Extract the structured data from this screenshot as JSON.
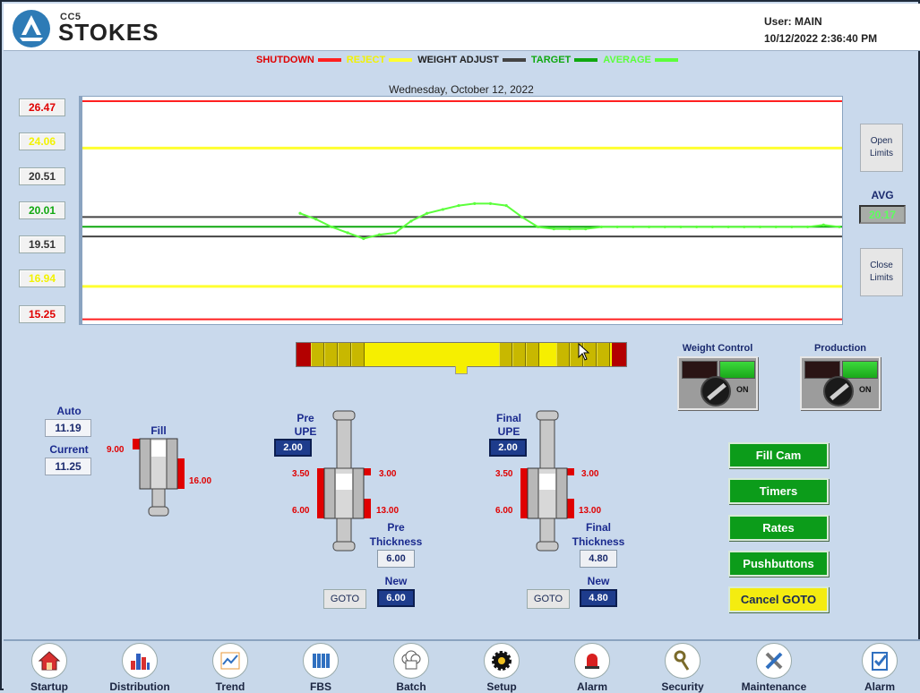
{
  "header": {
    "logo_sub": "CC5",
    "logo_text": "STOKES",
    "user": "User: MAIN",
    "datetime": "10/12/2022 2:36:40 PM"
  },
  "legend": [
    {
      "label": "SHUTDOWN",
      "color": "#ff2020",
      "text_color": "#e00000"
    },
    {
      "label": "REJECT",
      "color": "#ffff30",
      "text_color": "#f2f200"
    },
    {
      "label": "WEIGHT ADJUST",
      "color": "#444444",
      "text_color": "#222222"
    },
    {
      "label": "TARGET",
      "color": "#10a810",
      "text_color": "#10a810"
    },
    {
      "label": "AVERAGE",
      "color": "#5cff3c",
      "text_color": "#5cff3c"
    }
  ],
  "chart_date": "Wednesday, October 12, 2022",
  "limits": {
    "shutdown_high": "26.47",
    "reject_high": "24.06",
    "adjust_high": "20.51",
    "target": "20.01",
    "adjust_low": "19.51",
    "reject_low": "16.94",
    "shutdown_low": "15.25"
  },
  "chart_data": {
    "type": "line",
    "title": "",
    "ylim": [
      15.0,
      26.7
    ],
    "lines": [
      {
        "name": "SHUTDOWN",
        "y": 26.47,
        "color": "#ff2020"
      },
      {
        "name": "REJECT",
        "y": 24.06,
        "color": "#ffff30"
      },
      {
        "name": "WEIGHT ADJUST",
        "y": 20.51,
        "color": "#444444"
      },
      {
        "name": "TARGET",
        "y": 20.01,
        "color": "#10a810"
      },
      {
        "name": "WEIGHT ADJUST",
        "y": 19.51,
        "color": "#444444"
      },
      {
        "name": "REJECT",
        "y": 16.94,
        "color": "#ffff30"
      },
      {
        "name": "SHUTDOWN",
        "y": 15.25,
        "color": "#ff2020"
      }
    ],
    "series": [
      {
        "name": "AVERAGE",
        "color": "#5cff3c",
        "values": [
          20.7,
          20.4,
          20.0,
          19.7,
          19.4,
          19.6,
          19.7,
          20.3,
          20.7,
          20.9,
          21.1,
          21.2,
          21.2,
          21.1,
          20.5,
          20.0,
          19.9,
          19.9,
          19.9,
          20.0,
          20.0,
          20.0,
          20.0,
          20.0,
          20.0,
          20.0,
          20.0,
          20.0,
          20.0,
          20.0,
          20.0,
          20.0,
          20.0,
          20.1,
          20.0
        ]
      }
    ]
  },
  "buttons": {
    "open_limits": "Open Limits",
    "close_limits": "Close Limits",
    "avg_label": "AVG",
    "avg_value": "20.17"
  },
  "switches": {
    "weight_control": "Weight Control",
    "production": "Production",
    "on": "ON"
  },
  "fill": {
    "auto_label": "Auto",
    "auto_value": "11.19",
    "current_label": "Current",
    "current_value": "11.25",
    "fill_label": "Fill",
    "min": "9.00",
    "max": "16.00"
  },
  "pre": {
    "upe_label_1": "Pre",
    "upe_label_2": "UPE",
    "upe_value": "2.00",
    "top_left": "3.50",
    "top_right": "3.00",
    "bot_left": "6.00",
    "bot_right": "13.00",
    "thick_label_1": "Pre",
    "thick_label_2": "Thickness",
    "thick_value": "6.00",
    "new_label": "New",
    "new_value": "6.00",
    "goto": "GOTO"
  },
  "final": {
    "upe_label_1": "Final",
    "upe_label_2": "UPE",
    "upe_value": "2.00",
    "top_left": "3.50",
    "top_right": "3.00",
    "bot_left": "6.00",
    "bot_right": "13.00",
    "thick_label_1": "Final",
    "thick_label_2": "Thickness",
    "thick_value": "4.80",
    "new_label": "New",
    "new_value": "4.80",
    "goto": "GOTO"
  },
  "actions": {
    "fill_cam": "Fill Cam",
    "timers": "Timers",
    "rates": "Rates",
    "pushbuttons": "Pushbuttons",
    "cancel_goto": "Cancel GOTO"
  },
  "nav": [
    {
      "label": "Startup",
      "icon": "house-icon"
    },
    {
      "label": "Distribution",
      "icon": "bar-chart-icon"
    },
    {
      "label": "Trend",
      "icon": "trend-chart-icon"
    },
    {
      "label": "FBS",
      "icon": "fbs-icon"
    },
    {
      "label": "Batch",
      "icon": "chef-hat-icon"
    },
    {
      "label": "Setup",
      "icon": "gear-icon"
    },
    {
      "label": "Alarm",
      "icon": "alarm-bell-icon"
    },
    {
      "label": "Security",
      "icon": "key-icon"
    },
    {
      "label": "Maintenance",
      "icon": "tools-icon"
    },
    {
      "label": "Alarm",
      "icon": "clipboard-check-icon"
    }
  ]
}
